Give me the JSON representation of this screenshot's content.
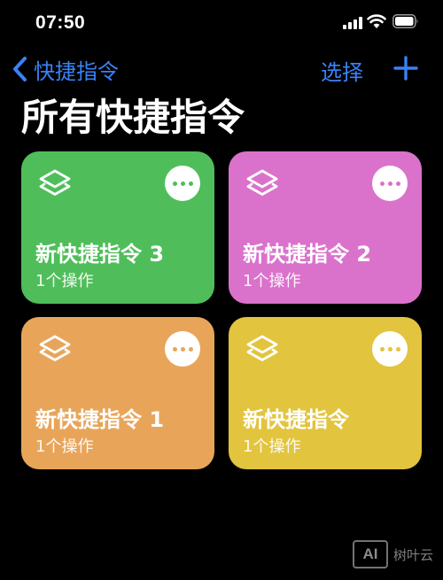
{
  "status_bar": {
    "time": "07:50"
  },
  "nav": {
    "back_label": "快捷指令",
    "select_label": "选择"
  },
  "page_title": "所有快捷指令",
  "tiles": [
    {
      "title": "新快捷指令 3",
      "subtitle": "1个操作",
      "color": "#4fbe5a"
    },
    {
      "title": "新快捷指令 2",
      "subtitle": "1个操作",
      "color": "#da72cc"
    },
    {
      "title": "新快捷指令 1",
      "subtitle": "1个操作",
      "color": "#e8a55a"
    },
    {
      "title": "新快捷指令",
      "subtitle": "1个操作",
      "color": "#e2c43e"
    }
  ],
  "accent_color": "#3a82f7",
  "icons": [
    "chevron-left-icon",
    "plus-icon",
    "shortcut-stack-icon",
    "more-icon",
    "signal-icon",
    "wifi-icon",
    "battery-icon"
  ],
  "watermark": {
    "logo": "AI",
    "text": "树叶云"
  }
}
